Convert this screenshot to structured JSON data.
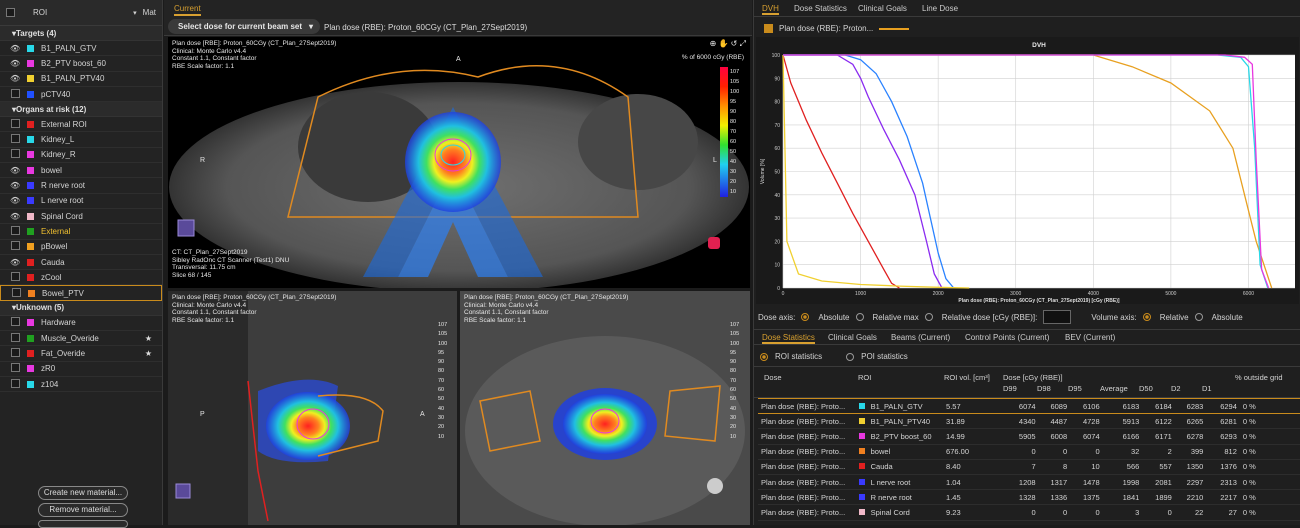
{
  "left": {
    "header_roi": "ROI",
    "header_mat": "Mat",
    "groups": [
      {
        "title": "Targets (4)",
        "items": [
          {
            "eye": true,
            "color": "#28d8e8",
            "label": "B1_PALN_GTV"
          },
          {
            "eye": true,
            "color": "#e838e0",
            "label": "B2_PTV boost_60"
          },
          {
            "eye": true,
            "color": "#f0d030",
            "label": "B1_PALN_PTV40"
          },
          {
            "eye": false,
            "color": "#2050ff",
            "label": "pCTV40"
          }
        ]
      },
      {
        "title": "Organs at risk (12)",
        "items": [
          {
            "eye": false,
            "color": "#e02020",
            "label": "External ROI"
          },
          {
            "eye": false,
            "color": "#28d8e8",
            "label": "Kidney_L"
          },
          {
            "eye": false,
            "color": "#e838e0",
            "label": "Kidney_R"
          },
          {
            "eye": true,
            "color": "#e838e0",
            "label": "bowel"
          },
          {
            "eye": true,
            "color": "#3a3aff",
            "label": "R nerve root"
          },
          {
            "eye": true,
            "color": "#3a3aff",
            "label": "L nerve root"
          },
          {
            "eye": true,
            "color": "#f0b8c8",
            "label": "Spinal Cord"
          },
          {
            "eye": false,
            "color": "#20a020",
            "label": "External"
          },
          {
            "eye": false,
            "color": "#f0a020",
            "label": "pBowel"
          },
          {
            "eye": true,
            "color": "#e02020",
            "label": "Cauda"
          },
          {
            "eye": false,
            "color": "#e02020",
            "label": "zCool"
          },
          {
            "eye": false,
            "color": "#f08020",
            "label": "Bowel_PTV"
          }
        ]
      },
      {
        "title": "Unknown (5)",
        "items": [
          {
            "eye": false,
            "color": "#e838e0",
            "label": "Hardware"
          },
          {
            "eye": false,
            "color": "#20a020",
            "label": "Muscle_Overide"
          },
          {
            "eye": false,
            "color": "#e02020",
            "label": "Fat_Overide"
          },
          {
            "eye": false,
            "color": "#e838e0",
            "label": "zR0"
          },
          {
            "eye": false,
            "color": "#28d8e8",
            "label": "z104"
          }
        ]
      }
    ],
    "btn_create": "Create new material...",
    "btn_remove": "Remove material..."
  },
  "center": {
    "tab": "Current",
    "beamset": "Select dose for current beam set",
    "plan_dose": "Plan dose (RBE): Proton_60CGy (CT_Plan_27Sept2019)",
    "ov1": [
      "Plan dose [RBE]: Proton_60CGy (CT_Plan_27Sept2019)",
      "Clinical: Monte Carlo v4.4",
      "Constant 1.1, Constant factor",
      "RBE Scale factor: 1.1"
    ],
    "ov2": [
      "CT: CT_Plan_27Sept2019",
      "Sibley RadOnc CT Scanner (Test1) DNU",
      "Transversal: 11.75 cm",
      "Slice 68 / 145"
    ],
    "legend_title": "% of 6000 cGy (RBE)",
    "legend": [
      "107",
      "105",
      "100",
      "95",
      "90",
      "80",
      "70",
      "60",
      "50",
      "40",
      "30",
      "20",
      "10"
    ],
    "orient_A": "A",
    "orient_P": "P",
    "orient_R": "R",
    "orient_L": "L"
  },
  "right": {
    "tabs": [
      "DVH",
      "Dose Statistics",
      "Clinical Goals",
      "Line Dose"
    ],
    "legend_label": "Plan dose (RBE): Proton...",
    "chart_title": "DVH",
    "xlabel": "Plan dose (RBE): Proton_60CGy (CT_Plan_27Sept2019) [cGy (RBE)]",
    "ylabel": "Volume [%]",
    "dose_axis": "Dose axis:",
    "abs": "Absolute",
    "relmax": "Relative max",
    "reldose": "Relative dose [cGy (RBE)]:",
    "vol_axis": "Volume axis:",
    "rel": "Relative",
    "abs2": "Absolute",
    "tabs2": [
      "Dose Statistics",
      "Clinical Goals",
      "Beams (Current)",
      "Control Points (Current)",
      "BEV (Current)"
    ],
    "roi_stats": "ROI statistics",
    "poi_stats": "POI statistics",
    "cols": [
      "Dose",
      "ROI",
      "ROI vol. [cm³]",
      "D99",
      "D98",
      "D95",
      "Average",
      "D50",
      "D2",
      "D1",
      "% outside grid"
    ],
    "dose_group": "Dose [cGy (RBE)]"
  },
  "chart_data": {
    "type": "line",
    "title": "DVH",
    "xlabel": "Plan dose (RBE): Proton_60CGy (CT_Plan_27Sept2019) [cGy (RBE)]",
    "ylabel": "Volume [%]",
    "xlim": [
      0,
      6600
    ],
    "ylim": [
      0,
      100
    ],
    "xticks": [
      0,
      1000,
      2000,
      3000,
      4000,
      5000,
      6000
    ],
    "yticks": [
      0,
      10,
      20,
      30,
      40,
      50,
      60,
      70,
      80,
      90,
      100
    ],
    "series": [
      {
        "color": "#e8a020",
        "x": [
          0,
          500,
          1000,
          2000,
          3000,
          4000,
          4500,
          5000,
          5500,
          5800,
          6100,
          6300
        ],
        "y": [
          100,
          100,
          100,
          100,
          100,
          100,
          95,
          88,
          76,
          60,
          20,
          0
        ]
      },
      {
        "color": "#2a82ff",
        "x": [
          0,
          800,
          1000,
          1200,
          1400,
          1600,
          1800,
          1900,
          2000,
          2100,
          2200
        ],
        "y": [
          100,
          100,
          98,
          92,
          80,
          65,
          45,
          30,
          15,
          4,
          0
        ]
      },
      {
        "color": "#8a2af0",
        "x": [
          0,
          700,
          900,
          1000,
          1100,
          1300,
          1500,
          1700,
          1850,
          1950,
          2050
        ],
        "y": [
          100,
          100,
          96,
          90,
          82,
          68,
          55,
          40,
          20,
          6,
          0
        ]
      },
      {
        "color": "#e02020",
        "x": [
          0,
          100,
          300,
          500,
          700,
          900,
          1100,
          1300,
          1400,
          1500
        ],
        "y": [
          100,
          88,
          72,
          58,
          45,
          32,
          20,
          8,
          2,
          0
        ]
      },
      {
        "color": "#f0d030",
        "x": [
          0,
          50,
          200,
          500,
          1000,
          1500,
          2000,
          2400
        ],
        "y": [
          100,
          20,
          6,
          3,
          1.5,
          0.8,
          0.3,
          0
        ]
      },
      {
        "color": "#28d8e8",
        "x": [
          0,
          5600,
          5900,
          6000,
          6080,
          6150,
          6250
        ],
        "y": [
          100,
          100,
          99,
          95,
          60,
          10,
          0
        ]
      },
      {
        "color": "#e838e0",
        "x": [
          0,
          5700,
          5950,
          6050,
          6100,
          6170,
          6260
        ],
        "y": [
          100,
          100,
          99,
          96,
          55,
          8,
          0
        ]
      }
    ]
  },
  "stats_rows": [
    {
      "dose": "Plan dose (RBE): Proto...",
      "color": "#28d8e8",
      "roi": "B1_PALN_GTV",
      "vol": "5.57",
      "d99": "6074",
      "d98": "6089",
      "d95": "6106",
      "avg": "6183",
      "d50": "6184",
      "d2": "6283",
      "d1": "6294",
      "out": "0 %"
    },
    {
      "dose": "Plan dose (RBE): Proto...",
      "color": "#f0d030",
      "roi": "B1_PALN_PTV40",
      "vol": "31.89",
      "d99": "4340",
      "d98": "4487",
      "d95": "4728",
      "avg": "5913",
      "d50": "6122",
      "d2": "6265",
      "d1": "6281",
      "out": "0 %"
    },
    {
      "dose": "Plan dose (RBE): Proto...",
      "color": "#e838e0",
      "roi": "B2_PTV boost_60",
      "vol": "14.99",
      "d99": "5905",
      "d98": "6008",
      "d95": "6074",
      "avg": "6166",
      "d50": "6171",
      "d2": "6278",
      "d1": "6293",
      "out": "0 %"
    },
    {
      "dose": "Plan dose (RBE): Proto...",
      "color": "#f08020",
      "roi": "bowel",
      "vol": "676.00",
      "d99": "0",
      "d98": "0",
      "d95": "0",
      "avg": "32",
      "d50": "2",
      "d2": "399",
      "d1": "812",
      "out": "0 %"
    },
    {
      "dose": "Plan dose (RBE): Proto...",
      "color": "#e02020",
      "roi": "Cauda",
      "vol": "8.40",
      "d99": "7",
      "d98": "8",
      "d95": "10",
      "avg": "566",
      "d50": "557",
      "d2": "1350",
      "d1": "1376",
      "out": "0 %"
    },
    {
      "dose": "Plan dose (RBE): Proto...",
      "color": "#3a3aff",
      "roi": "L nerve root",
      "vol": "1.04",
      "d99": "1208",
      "d98": "1317",
      "d95": "1478",
      "avg": "1998",
      "d50": "2081",
      "d2": "2297",
      "d1": "2313",
      "out": "0 %"
    },
    {
      "dose": "Plan dose (RBE): Proto...",
      "color": "#3a3aff",
      "roi": "R nerve root",
      "vol": "1.45",
      "d99": "1328",
      "d98": "1336",
      "d95": "1375",
      "avg": "1841",
      "d50": "1899",
      "d2": "2210",
      "d1": "2217",
      "out": "0 %"
    },
    {
      "dose": "Plan dose (RBE): Proto...",
      "color": "#f0b8c8",
      "roi": "Spinal Cord",
      "vol": "9.23",
      "d99": "0",
      "d98": "0",
      "d95": "0",
      "avg": "3",
      "d50": "0",
      "d2": "22",
      "d1": "27",
      "out": "0 %"
    }
  ]
}
